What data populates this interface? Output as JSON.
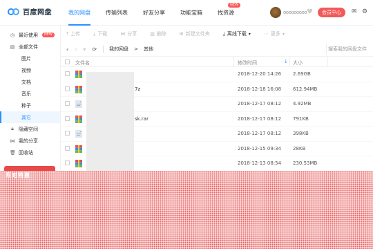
{
  "header": {
    "logo_text": "百度网盘",
    "nav": [
      {
        "label": "我的网盘",
        "active": true
      },
      {
        "label": "传输列表"
      },
      {
        "label": "好友分享"
      },
      {
        "label": "功能宝箱"
      },
      {
        "label": "找资源",
        "badge": "NEW"
      }
    ],
    "username": "ooooooooo",
    "vip_label": "会员中心"
  },
  "sidebar": {
    "items": [
      {
        "label": "最近使用",
        "icon": "clock-icon",
        "badge": "NEW"
      },
      {
        "label": "全部文件",
        "icon": "file-icon"
      },
      {
        "label": "图片",
        "sub": true
      },
      {
        "label": "视频",
        "sub": true
      },
      {
        "label": "文档",
        "sub": true
      },
      {
        "label": "音乐",
        "sub": true
      },
      {
        "label": "种子",
        "sub": true
      },
      {
        "label": "其它",
        "sub": true,
        "active": true
      },
      {
        "label": "隐藏空间",
        "icon": "lock-icon"
      },
      {
        "label": "我的分享",
        "icon": "share-icon"
      },
      {
        "label": "回收站",
        "icon": "trash-icon"
      }
    ],
    "promo_text": "限时特惠"
  },
  "toolbar": {
    "upload": "上传",
    "download": "下载",
    "share": "分享",
    "delete": "删除",
    "new_folder": "新建文件夹",
    "offline_download": "离线下载",
    "more": "更多"
  },
  "path": {
    "crumbs": [
      "我的网盘",
      "其他"
    ],
    "search_placeholder": "搜索我的网盘文件"
  },
  "table": {
    "col_name": "文件名",
    "col_time": "修改时间",
    "col_size": "大小",
    "rows": [
      {
        "name": "",
        "time": "2018-12-20 14:26",
        "size": "2.69GB",
        "icon": "rar"
      },
      {
        "name": "7z",
        "time": "2018-12-18 16:08",
        "size": "612.94MB",
        "icon": "rar"
      },
      {
        "name": "",
        "time": "2018-12-17 08:12",
        "size": "4.92MB",
        "icon": "doc"
      },
      {
        "name": "sk.rar",
        "time": "2018-12-17 08:12",
        "size": "791KB",
        "icon": "rar"
      },
      {
        "name": "",
        "time": "2018-12-17 08:12",
        "size": "398KB",
        "icon": "doc"
      },
      {
        "name": "",
        "time": "2018-12-15 09:34",
        "size": "28KB",
        "icon": "rar"
      },
      {
        "name": "",
        "time": "2018-12-13 08:54",
        "size": "230.53MB",
        "icon": "rar"
      }
    ]
  }
}
